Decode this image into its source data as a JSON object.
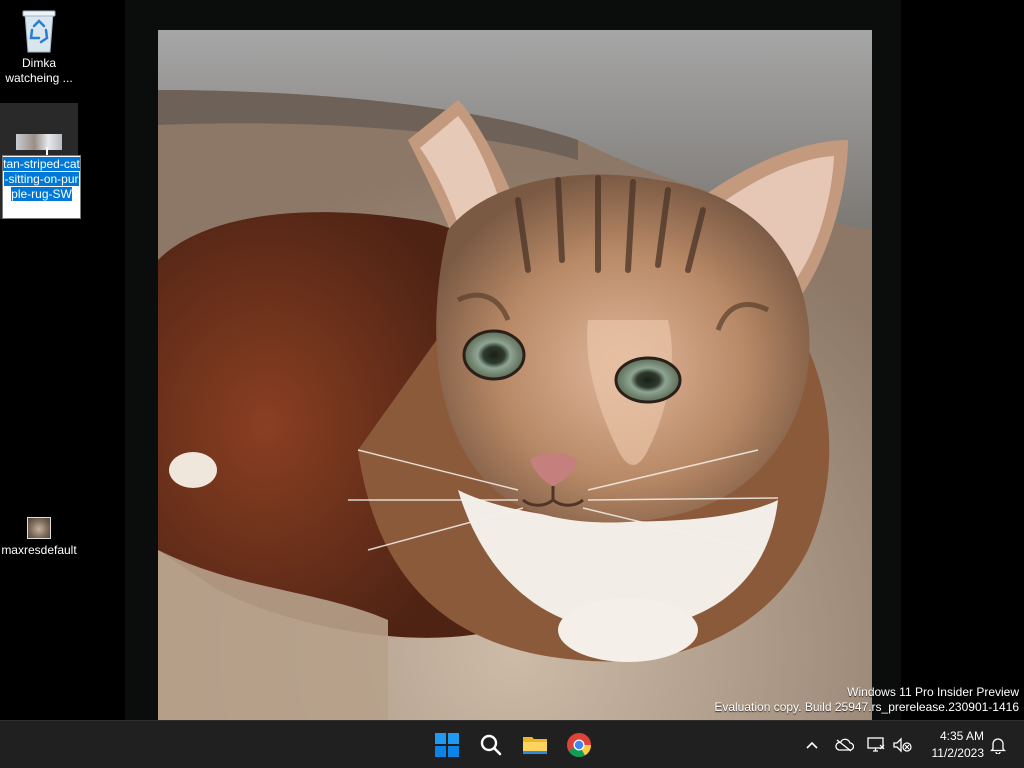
{
  "desktop": {
    "icons": [
      {
        "id": "recycle-bin",
        "label": "Dimka watcheing ...",
        "icon": "recycle-bin-icon"
      },
      {
        "id": "cat-image-file",
        "label": "tan-striped-cat-sitting-on-purple-rug-SW",
        "icon": "image-thumbnail-icon",
        "state": "renaming"
      },
      {
        "id": "maxres-file",
        "label": "maxresdefault",
        "icon": "image-thumbnail-icon"
      }
    ],
    "wallpaper": "cat-photo"
  },
  "watermark": {
    "line1": "Windows 11 Pro Insider Preview",
    "line2": "Evaluation copy. Build 25947.rs_prerelease.230901-1416"
  },
  "taskbar": {
    "apps": [
      {
        "name": "start",
        "icon": "windows-logo-icon"
      },
      {
        "name": "search",
        "icon": "search-icon"
      },
      {
        "name": "file-explorer",
        "icon": "folder-icon"
      },
      {
        "name": "chrome",
        "icon": "chrome-icon"
      }
    ],
    "tray": {
      "icons": [
        "chevron-up-icon",
        "onedrive-cloud-icon",
        "network-icon",
        "volume-muted-icon",
        "notification-bell-icon"
      ],
      "time": "4:35 AM",
      "date": "11/2/2023"
    }
  },
  "colors": {
    "taskbar": "#202020",
    "selection": "#0078d7",
    "start_blue": "#0a84e6"
  }
}
